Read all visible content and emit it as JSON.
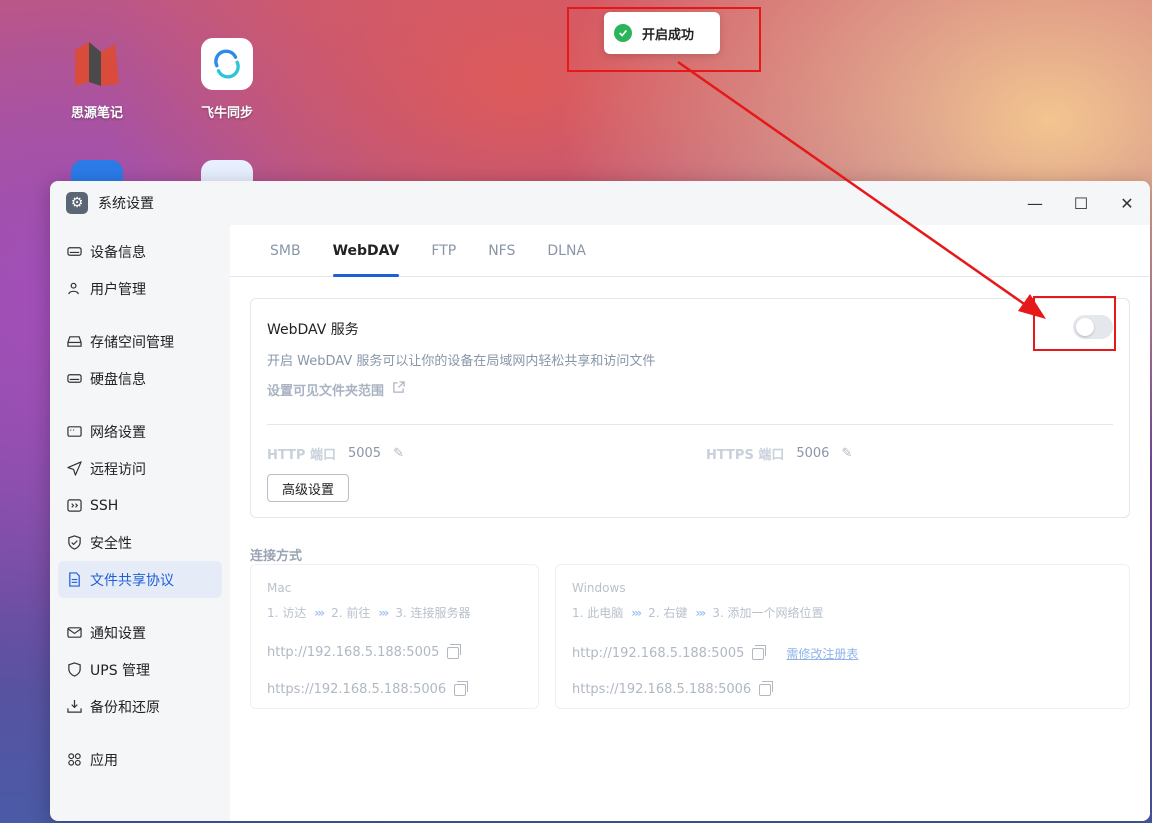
{
  "desktop": {
    "icons": [
      {
        "label": "思源笔记",
        "icon": "siyuan-icon"
      },
      {
        "label": "飞牛同步",
        "icon": "sync-icon"
      }
    ]
  },
  "toast": {
    "message": "开启成功",
    "icon": "check-circle-icon"
  },
  "window": {
    "title": "系统设置",
    "controls": {
      "minimize": "—",
      "maximize": "☐",
      "close": "✕"
    }
  },
  "sidebar": {
    "items": [
      {
        "label": "设备信息",
        "icon": "device-icon"
      },
      {
        "label": "用户管理",
        "icon": "users-icon"
      },
      {
        "label": "存储空间管理",
        "icon": "storage-icon"
      },
      {
        "label": "硬盘信息",
        "icon": "disk-icon"
      },
      {
        "label": "网络设置",
        "icon": "network-icon"
      },
      {
        "label": "远程访问",
        "icon": "remote-icon"
      },
      {
        "label": "SSH",
        "icon": "terminal-icon"
      },
      {
        "label": "安全性",
        "icon": "shield-icon"
      },
      {
        "label": "文件共享协议",
        "icon": "file-share-icon",
        "active": true
      },
      {
        "label": "通知设置",
        "icon": "mail-icon"
      },
      {
        "label": "UPS 管理",
        "icon": "ups-icon"
      },
      {
        "label": "备份和还原",
        "icon": "backup-icon"
      },
      {
        "label": "应用",
        "icon": "apps-icon"
      }
    ]
  },
  "tabs": [
    {
      "label": "SMB"
    },
    {
      "label": "WebDAV",
      "active": true
    },
    {
      "label": "FTP"
    },
    {
      "label": "NFS"
    },
    {
      "label": "DLNA"
    }
  ],
  "service": {
    "title": "WebDAV 服务",
    "description": "开启 WebDAV 服务可以让你的设备在局域网内轻松共享和访问文件",
    "scope_link": "设置可见文件夹范围",
    "enabled": false,
    "http_label": "HTTP 端口",
    "http_port": "5005",
    "https_label": "HTTPS 端口",
    "https_port": "5006",
    "advanced_button": "高级设置"
  },
  "connection": {
    "title": "连接方式",
    "mac": {
      "os": "Mac",
      "steps": [
        "1. 访达",
        "2. 前往",
        "3. 连接服务器"
      ],
      "http_url": "http://192.168.5.188:5005",
      "https_url": "https://192.168.5.188:5006"
    },
    "windows": {
      "os": "Windows",
      "steps": [
        "1. 此电脑",
        "2. 右键",
        "3. 添加一个网络位置"
      ],
      "http_url": "http://192.168.5.188:5005",
      "https_url": "https://192.168.5.188:5006",
      "registry_link": "需修改注册表"
    }
  },
  "colors": {
    "accent": "#1e5fd7",
    "annotation": "#e51919",
    "success": "#2bb55b"
  }
}
